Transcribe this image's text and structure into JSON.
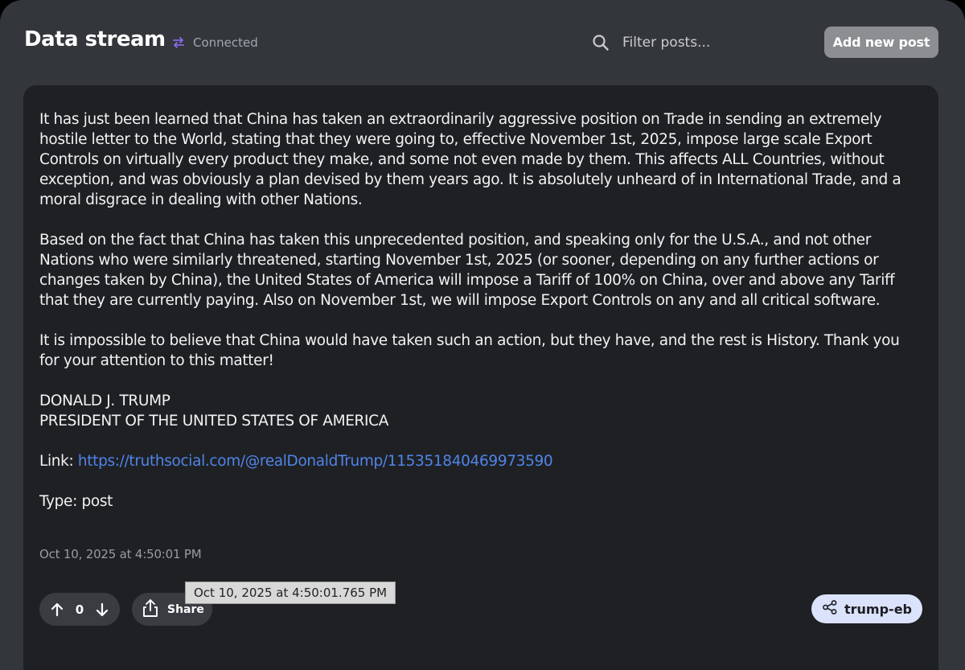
{
  "header": {
    "title": "Data stream",
    "status": "Connected",
    "search_placeholder": "Filter posts...",
    "add_button_label": "Add new post"
  },
  "post": {
    "paragraphs": [
      "It has just been learned that China has taken an extraordinarily aggressive position on Trade in sending an extremely hostile letter to the World, stating that they were going to, effective November 1st, 2025, impose large scale Export Controls on virtually every product they make, and some not even made by them. This affects ALL Countries, without exception, and was obviously a plan devised by them years ago. It is absolutely unheard of in International Trade, and a moral disgrace in dealing with other Nations.",
      "Based on the fact that China has taken this unprecedented position, and speaking only for the U.S.A., and not other Nations who were similarly threatened, starting November 1st, 2025 (or sooner, depending on any further actions or changes taken by China), the United States of America will impose a Tariff of 100% on China, over and above any Tariff that they are currently paying. Also on November 1st, we will impose Export Controls on any and all critical software.",
      "It is impossible to believe that China would have taken such an action, but they have, and the rest is History. Thank you for your attention to this matter!"
    ],
    "signature_name": "DONALD J. TRUMP",
    "signature_title": "PRESIDENT OF THE UNITED STATES OF AMERICA",
    "link_label": "Link:",
    "link_url": "https://truthsocial.com/@realDonaldTrump/115351840469973590",
    "type_text": "Type: post",
    "timestamp": "Oct 10, 2025 at 4:50:01 PM",
    "timestamp_tooltip": "Oct 10, 2025 at 4:50:01.765 PM",
    "vote_count": "0",
    "share_label": "Share",
    "source_tag": "trump-eb"
  },
  "colors": {
    "background": "#33363b",
    "card": "#1f2024",
    "link": "#4f84e8",
    "tag_bg": "#dbe2fb",
    "status_icon": "#8b6cf0"
  },
  "icons": {
    "status": "sync-arrows-icon",
    "search": "search-icon",
    "upvote": "arrow-up-icon",
    "downvote": "arrow-down-icon",
    "share": "share-upload-icon",
    "tag": "share-nodes-icon"
  }
}
